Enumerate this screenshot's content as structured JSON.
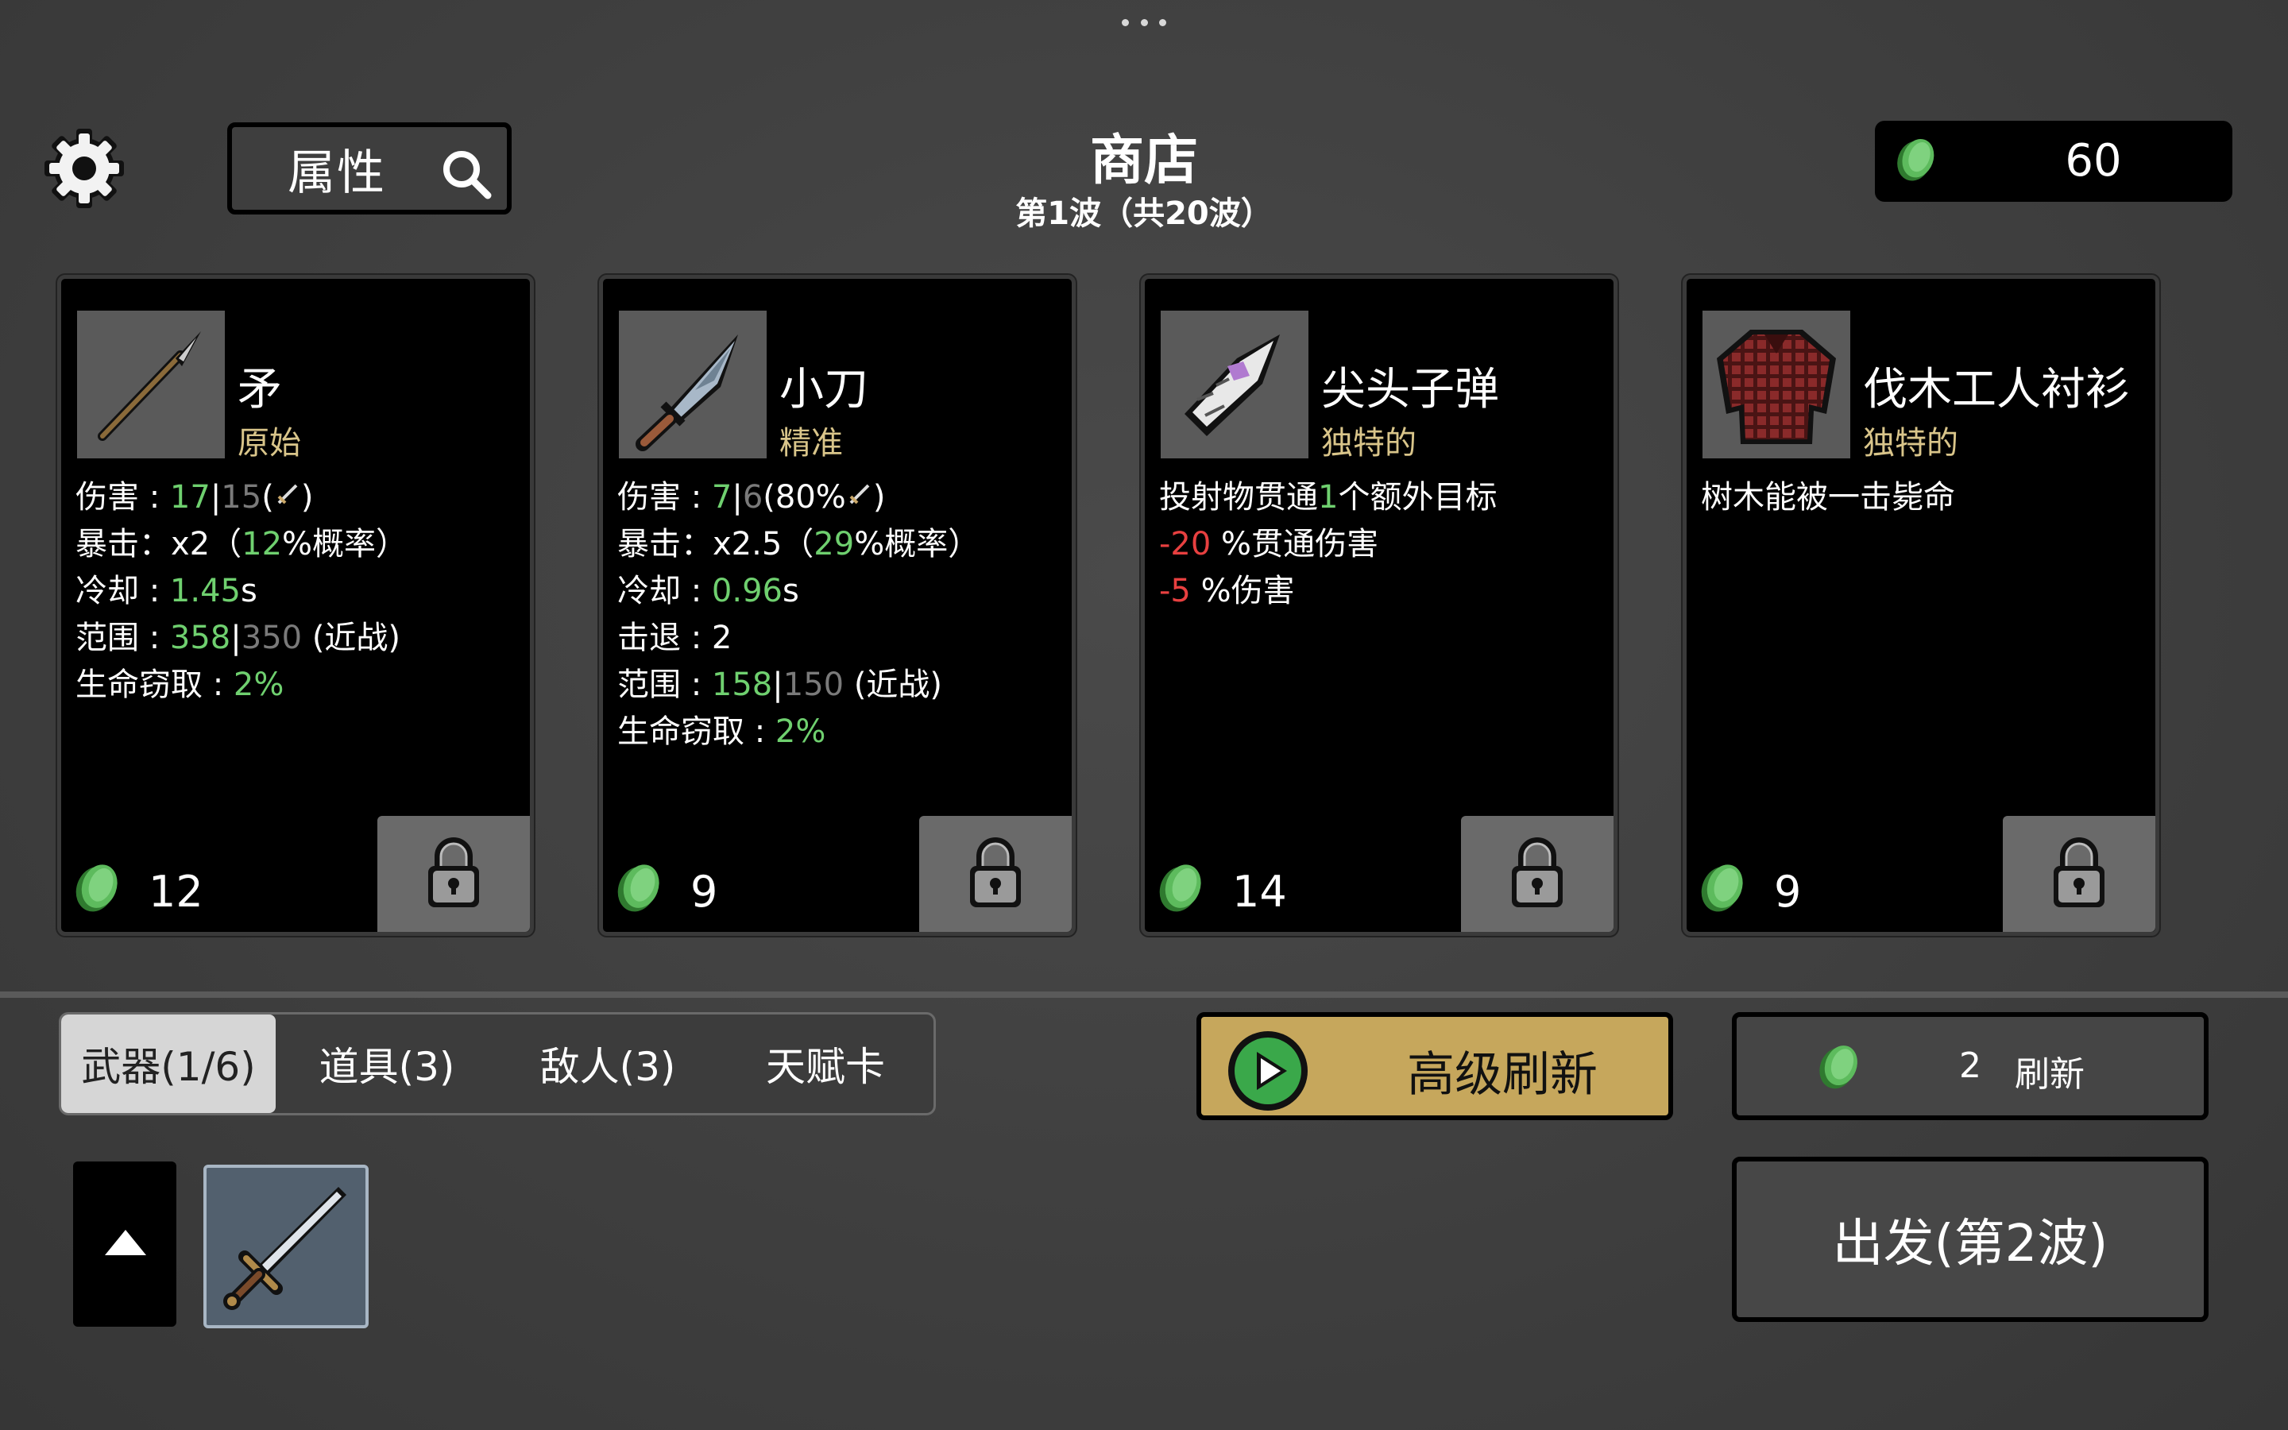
{
  "header": {
    "title": "商店",
    "subtitle": "第1波（共20波）",
    "attr_label": "属性",
    "money": "60"
  },
  "cards": [
    {
      "name": "矛",
      "tier": "原始",
      "price": "12",
      "stats": {
        "dmg_label": "伤害 : ",
        "dmg_cur": "17",
        "dmg_sep": "|",
        "dmg_base": "15",
        "dmg_paren_open": "(",
        "dmg_paren_close": ")",
        "crit": "暴击：x2（",
        "crit_val": "12",
        "crit_tail": "%概率）",
        "cd_label": "冷却 : ",
        "cd_val": "1.45",
        "cd_unit": "s",
        "range_label": "范围 : ",
        "range_cur": "358",
        "range_sep": "|",
        "range_base": "350",
        "range_tail": " (近战)",
        "ls_label": "生命窃取 : ",
        "ls_val": "2%"
      }
    },
    {
      "name": "小刀",
      "tier": "精准",
      "price": "9",
      "stats": {
        "dmg_label": "伤害 : ",
        "dmg_cur": "7",
        "dmg_sep": "|",
        "dmg_base": "6",
        "dmg_paren_open": "(80%",
        "dmg_paren_close": ")",
        "crit": "暴击：x2.5（",
        "crit_val": "29",
        "crit_tail": "%概率）",
        "cd_label": "冷却 : ",
        "cd_val": "0.96",
        "cd_unit": "s",
        "kb": "击退 : 2",
        "range_label": "范围 : ",
        "range_cur": "158",
        "range_sep": "|",
        "range_base": "150",
        "range_tail": " (近战)",
        "ls_label": "生命窃取 : ",
        "ls_val": "2%"
      }
    },
    {
      "name": "尖头子弹",
      "tier": "独特的",
      "price": "14",
      "stats": {
        "l1_a": "投射物贯通",
        "l1_b": "1",
        "l1_c": "个额外目标",
        "l2_a": "-20",
        "l2_b": " %贯通伤害",
        "l3_a": "-5",
        "l3_b": " %伤害"
      }
    },
    {
      "name": "伐木工人衬衫",
      "tier": "独特的",
      "price": "9",
      "stats": {
        "l1": "树木能被一击毙命"
      }
    }
  ],
  "tabs": [
    {
      "label": "武器(1/6)",
      "active": true
    },
    {
      "label": "道具(3)",
      "active": false
    },
    {
      "label": "敌人(3)",
      "active": false
    },
    {
      "label": "天赋卡",
      "active": false
    }
  ],
  "actions": {
    "premium_refresh": "高级刷新",
    "refresh_cost": "2",
    "refresh_label": "刷新",
    "go_label": "出发(第2波)"
  },
  "colors": {
    "stat_green": "#6fd06f",
    "stat_red": "#e84040",
    "tier_gold": "#d9c58a",
    "premium_gold": "#c6a75c"
  },
  "icons": {
    "card_0": "spear-icon",
    "card_1": "knife-icon",
    "card_2": "pointed-bullet-icon",
    "card_3": "lumberjack-shirt-icon",
    "inventory_0": "sword-icon"
  }
}
